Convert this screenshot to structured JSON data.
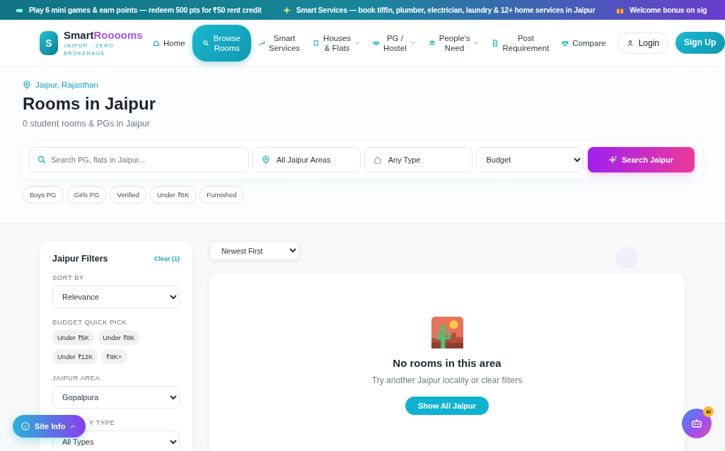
{
  "ticker": [
    {
      "kind": "game",
      "text": "Play 6 mini games & earn points — redeem 500 pts for ₹50 rent credit"
    },
    {
      "kind": "sparkle",
      "text": "Smart Services — book tiffin, plumber, electrician, laundry & 12+ home services in Jaipur"
    },
    {
      "kind": "gift",
      "text": "Welcome bonus on sig"
    }
  ],
  "brand": {
    "logo_letter": "S",
    "name_first": "Smart",
    "name_second": "Rooooms",
    "tagline": "JAIPUR · ZERO BROKERAGE"
  },
  "nav": [
    {
      "label": "Home",
      "selected": false,
      "dropdown": false
    },
    {
      "label": "Browse Rooms",
      "selected": true,
      "dropdown": false
    },
    {
      "label": "Smart Services",
      "selected": false,
      "dropdown": false
    },
    {
      "label": "Houses & Flats",
      "selected": false,
      "dropdown": true
    },
    {
      "label": "PG / Hostel",
      "selected": false,
      "dropdown": true
    },
    {
      "label": "People's Need",
      "selected": false,
      "dropdown": true
    },
    {
      "label": "Post Requirement",
      "selected": false,
      "dropdown": false
    },
    {
      "label": "Compare",
      "selected": false,
      "dropdown": false
    }
  ],
  "login": "Login",
  "signup": "Sign Up",
  "hero": {
    "location": "Jaipur, Rajasthan",
    "title": "Rooms in Jaipur",
    "subtitle": "0 student rooms & PGs in Jaipur"
  },
  "search": {
    "placeholder": "Search PG, flats in Jaipur...",
    "area": "All Jaipur Areas",
    "type": "Any Type",
    "budget": "Budget",
    "button": "Search Jaipur"
  },
  "chips": [
    "Boys PG",
    "Girls PG",
    "Verified",
    "Under ₹6K",
    "Furnished"
  ],
  "filters": {
    "title": "Jaipur Filters",
    "clear": "Clear (1)",
    "sections": [
      {
        "kind": "select",
        "label": "SORT BY",
        "value": "Relevance"
      },
      {
        "kind": "chips",
        "label": "BUDGET QUICK PICK",
        "chips": [
          "Under ₹5K",
          "Under ₹8K",
          "Under ₹12K",
          "₹8K+"
        ]
      },
      {
        "kind": "select",
        "label": "JAIPUR AREA",
        "value": "Gopalpura"
      },
      {
        "kind": "select",
        "label": "Y TYPE",
        "value": "All Types",
        "covered": true
      }
    ]
  },
  "results": {
    "sort": "Newest First",
    "empty_title": "No rooms in this area",
    "empty_text": "Try another Jaipur locality or clear filters",
    "empty_button": "Show All Jaipur"
  },
  "site_info": "Site Info",
  "ai_badge": "AI"
}
